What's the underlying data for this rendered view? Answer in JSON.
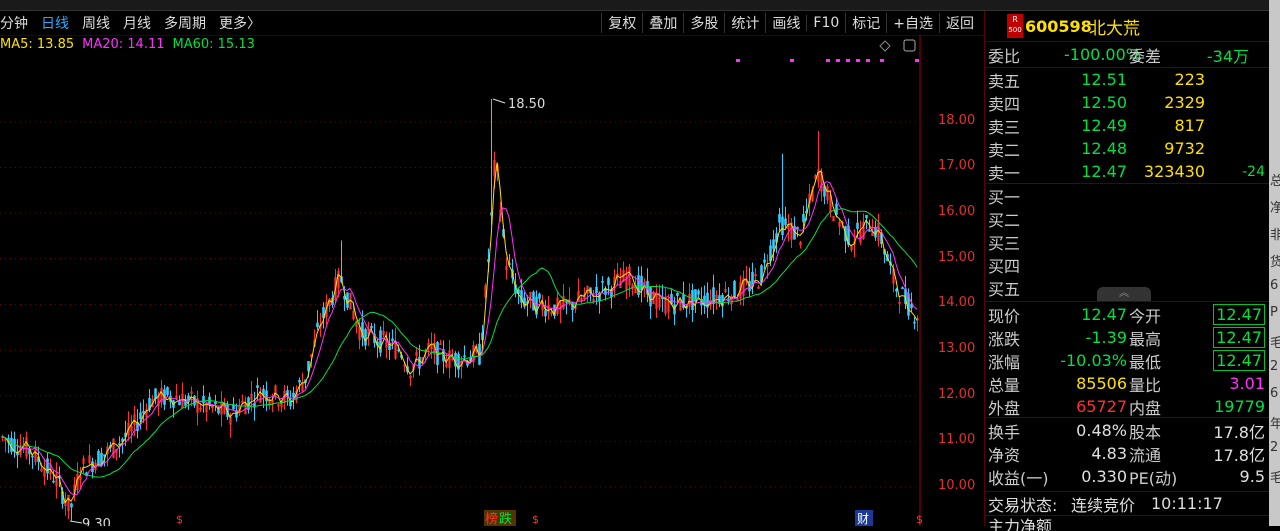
{
  "toolbar": {
    "periods": [
      "分钟",
      "日线",
      "周线",
      "月线",
      "多周期",
      "更多〉"
    ],
    "active_period": "日线",
    "actions": [
      "复权",
      "叠加",
      "多股",
      "统计",
      "画线",
      "F10",
      "标记",
      "+自选",
      "返回"
    ]
  },
  "ma_legend": [
    {
      "label": "MA5: 13.85",
      "color": "#ffe000"
    },
    {
      "label": "MA20: 14.11",
      "color": "#ff30ff"
    },
    {
      "label": "MA60: 15.13",
      "color": "#00e040"
    }
  ],
  "chart_annotations": {
    "high": "18.50",
    "low": "9.30"
  },
  "chart_data": {
    "type": "candlestick",
    "y_ticks": [
      "18.00",
      "17.00",
      "16.00",
      "15.00",
      "14.00",
      "13.00",
      "12.00",
      "11.00",
      "10.00"
    ],
    "y_range": [
      9.3,
      18.5
    ],
    "high_value": 18.5,
    "low_value": 9.3,
    "bottom_badges": [
      "榜",
      "跌",
      "财"
    ],
    "colors": {
      "up": "#ff3030",
      "down": "#33ccff",
      "ma5": "#ffe000",
      "ma20": "#ff30ff",
      "ma60": "#00e040",
      "axis": "#e23030"
    }
  },
  "quote": {
    "stock_badge_top": "R",
    "stock_badge_bottom": "500",
    "code": "600598",
    "name": "北大荒",
    "weibi_label": "委比",
    "weibi_value": "-100.00%",
    "weicha_label": "委差",
    "weicha_value": "-34万",
    "sells": [
      {
        "label": "卖五",
        "price": "12.51",
        "vol": "223"
      },
      {
        "label": "卖四",
        "price": "12.50",
        "vol": "2329"
      },
      {
        "label": "卖三",
        "price": "12.49",
        "vol": "817"
      },
      {
        "label": "卖二",
        "price": "12.48",
        "vol": "9732"
      },
      {
        "label": "卖一",
        "price": "12.47",
        "vol": "323430",
        "chg": "-24"
      }
    ],
    "buys": [
      {
        "label": "买一"
      },
      {
        "label": "买二"
      },
      {
        "label": "买三"
      },
      {
        "label": "买四"
      },
      {
        "label": "买五"
      }
    ],
    "stats": [
      {
        "l1": "现价",
        "v1": "12.47",
        "l2": "今开",
        "v2": "12.47",
        "c1": "#00e040",
        "c2": "#00e040",
        "box": true
      },
      {
        "l1": "涨跌",
        "v1": "-1.39",
        "l2": "最高",
        "v2": "12.47",
        "c1": "#00e040",
        "c2": "#00e040",
        "box": true
      },
      {
        "l1": "涨幅",
        "v1": "-10.03%",
        "l2": "最低",
        "v2": "12.47",
        "c1": "#00e040",
        "c2": "#00e040",
        "box": true
      },
      {
        "l1": "总量",
        "v1": "85506",
        "l2": "量比",
        "v2": "3.01",
        "c1": "#ffe000",
        "c2": "#ff30ff",
        "box": false
      },
      {
        "l1": "外盘",
        "v1": "65727",
        "l2": "内盘",
        "v2": "19779",
        "c1": "#ff3030",
        "c2": "#00e040",
        "box": false
      },
      {
        "l1": "换手",
        "v1": "0.48%",
        "l2": "股本",
        "v2": "17.8亿",
        "c1": "#e0e0e0",
        "c2": "#e0e0e0",
        "box": false
      },
      {
        "l1": "净资",
        "v1": "4.83",
        "l2": "流通",
        "v2": "17.8亿",
        "c1": "#e0e0e0",
        "c2": "#e0e0e0",
        "box": false
      },
      {
        "l1": "收益(一)",
        "v1": "0.330",
        "l2": "PE(动)",
        "v2": "9.5",
        "c1": "#e0e0e0",
        "c2": "#e0e0e0",
        "box": false
      }
    ],
    "status_label": "交易状态:",
    "status_value": "连续竞价",
    "status_time": "10:11:17",
    "bottom_partial": "主力净额"
  },
  "right_edge_chars": [
    "总",
    "净",
    "非",
    "货",
    "6",
    "P",
    "毛",
    "2",
    "6",
    "年",
    "2",
    "毛"
  ]
}
